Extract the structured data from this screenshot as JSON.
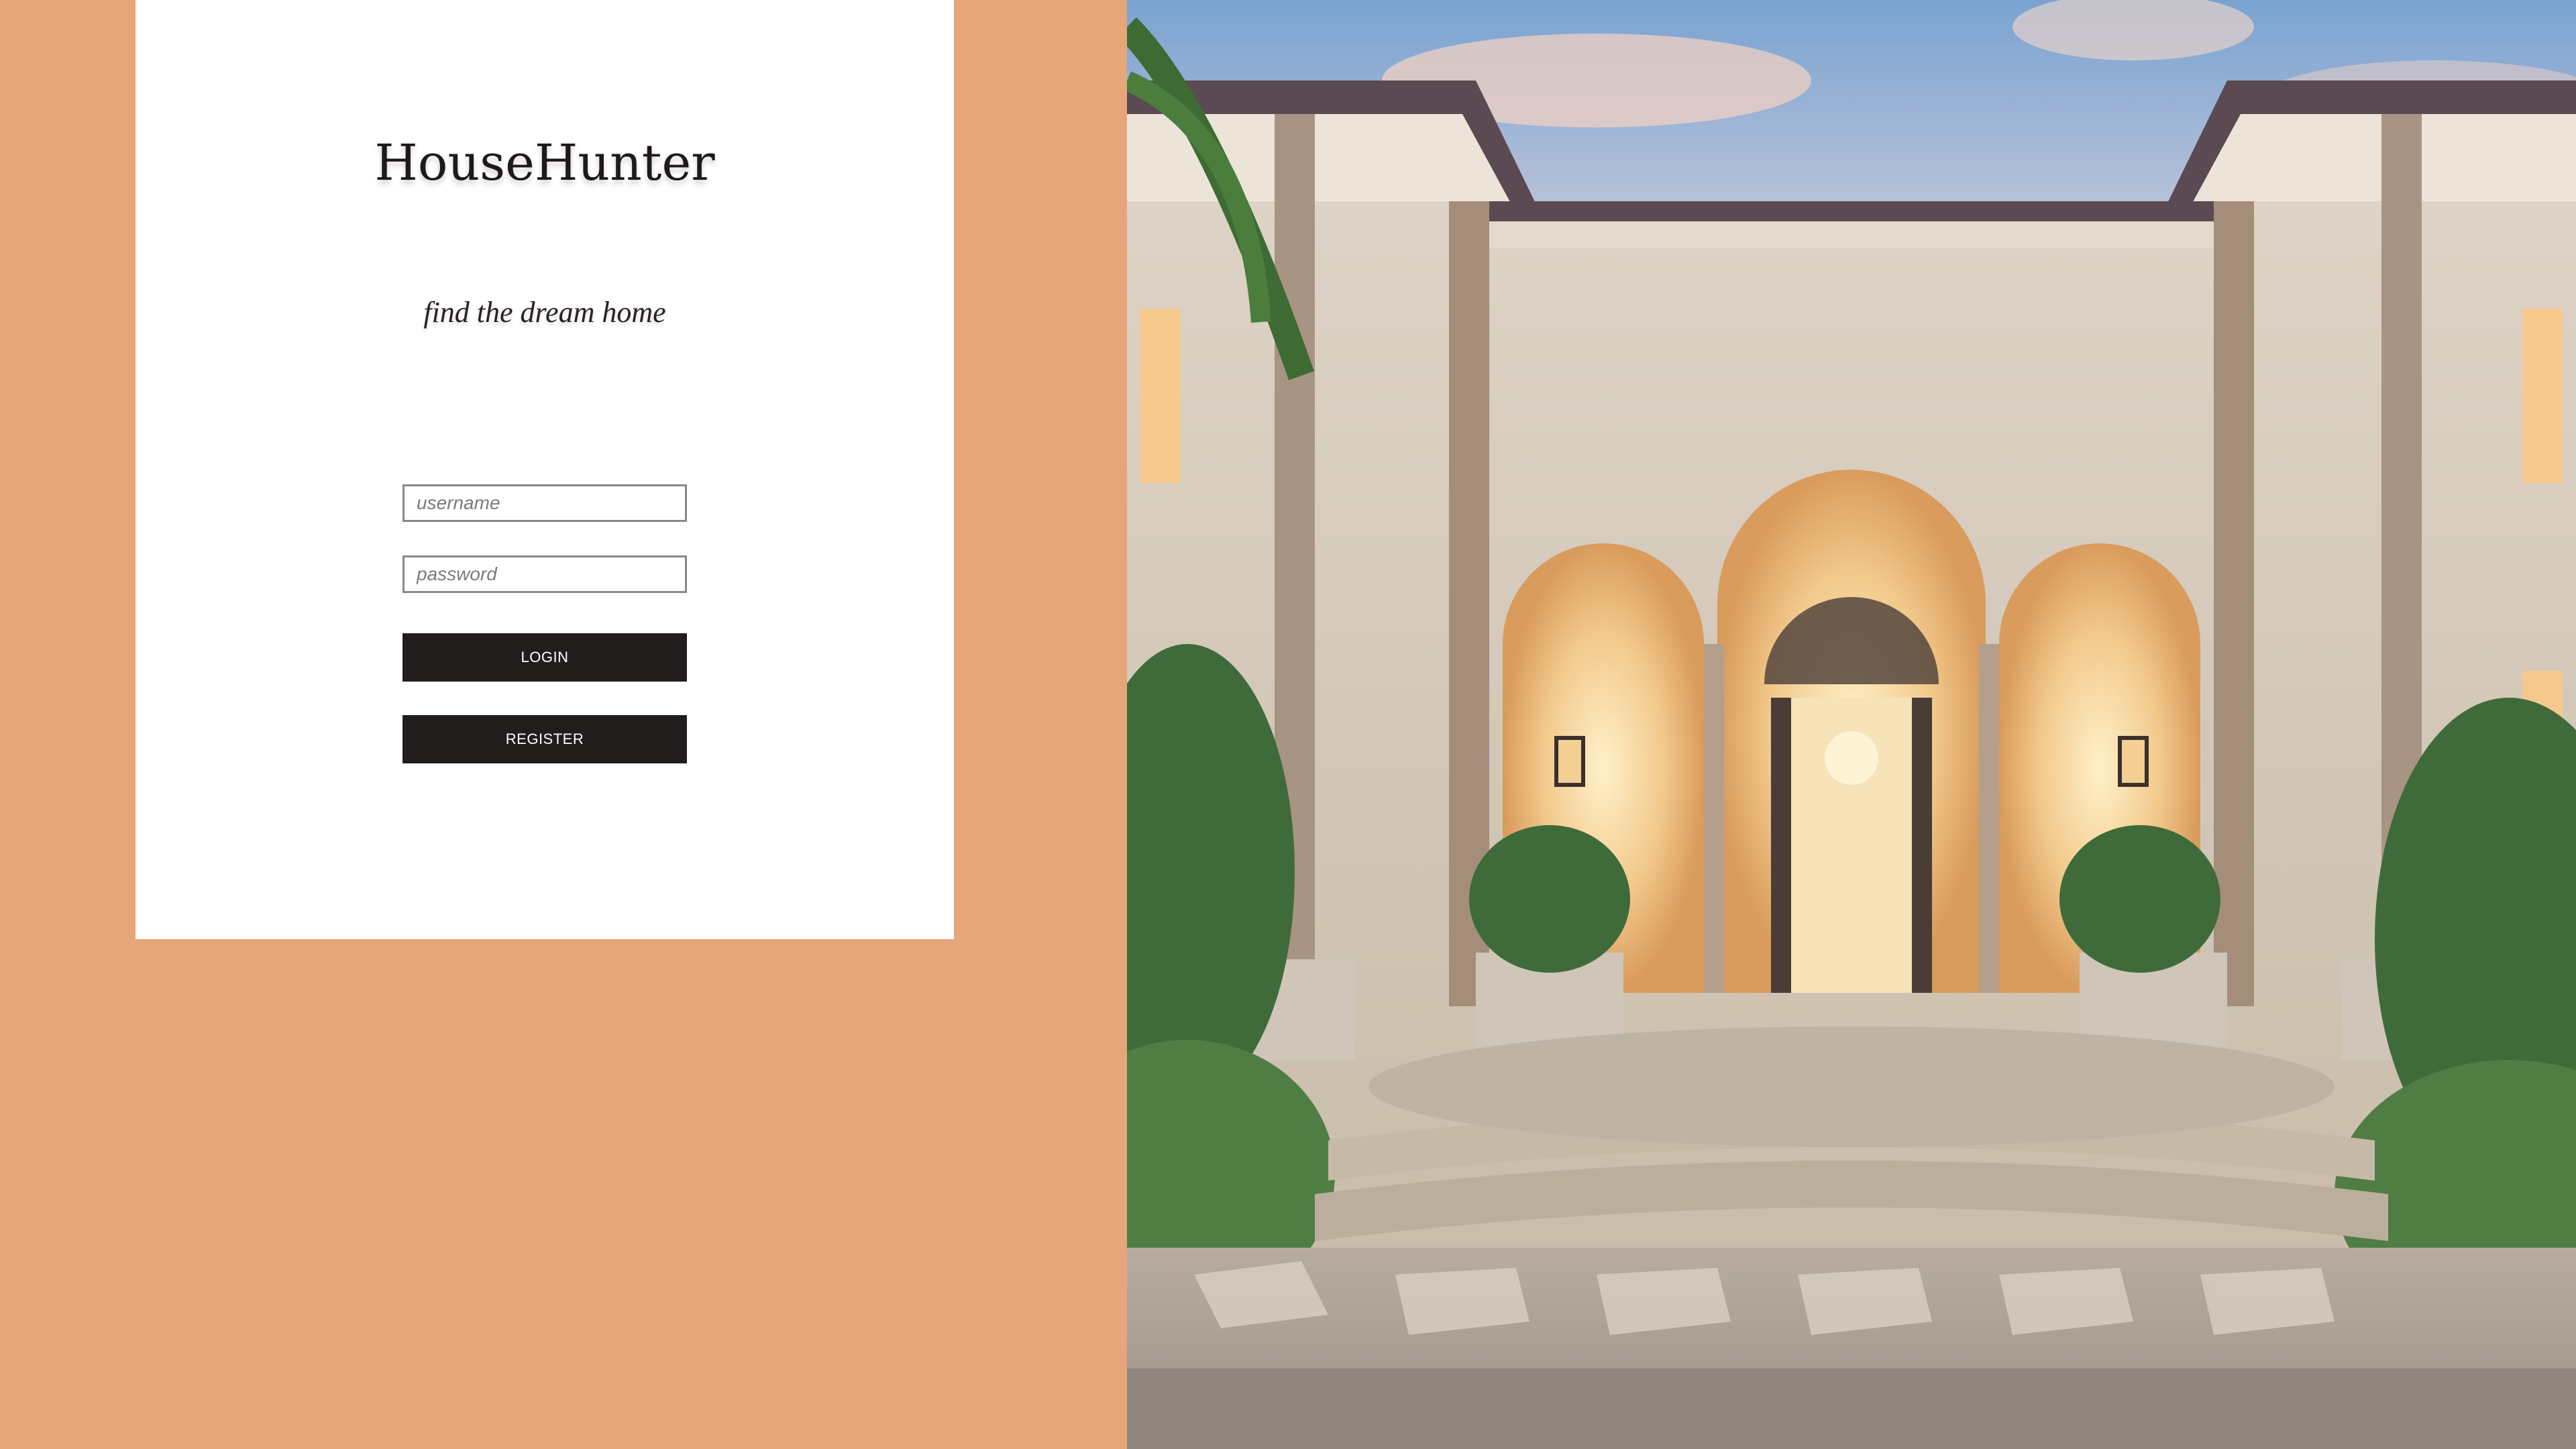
{
  "brand": {
    "title": "HouseHunter",
    "tagline": "find the dream home"
  },
  "login_form": {
    "username_placeholder": "username",
    "password_placeholder": "password",
    "login_label": "LOGIN",
    "register_label": "REGISTER"
  },
  "hero_image": {
    "subject": "luxury-villa-entrance"
  },
  "colors": {
    "background": "#e6a67a",
    "card": "#ffffff",
    "button": "#221d1d",
    "button_text": "#ffffff"
  }
}
